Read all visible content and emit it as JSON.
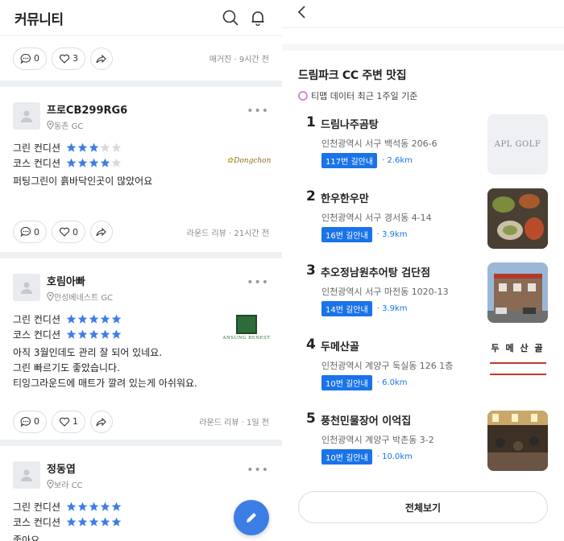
{
  "left": {
    "title": "커뮤니티",
    "top_actions": {
      "comments": "0",
      "likes": "3",
      "meta": "매거진 · 9시간 전"
    },
    "posts": [
      {
        "name": "프로CB299RG6",
        "course": "동촌 GC",
        "green_label": "그린 컨디션",
        "green_stars": 3,
        "course_label": "코스 컨디션",
        "course_stars": 4,
        "text": "퍼팅그린이 흙바닥인곳이 많았어요",
        "logo": "Dongchon",
        "comments": "0",
        "likes": "0",
        "meta": "라운드 리뷰 · 21시간 전"
      },
      {
        "name": "호림아빠",
        "course": "안성베네스트 GC",
        "green_label": "그린 컨디션",
        "green_stars": 5,
        "course_label": "코스 컨디션",
        "course_stars": 5,
        "text_lines": [
          "아직 3월인데도 관리 잘 되어 있네요.",
          "그린 빠르기도 좋았습니다.",
          "티잉그라운드에 매트가 깔려 있는게 아쉬워요."
        ],
        "logo": "ANSUNG BENEST",
        "comments": "0",
        "likes": "1",
        "meta": "라운드 리뷰 · 1일 전"
      },
      {
        "name": "정동엽",
        "course": "보라 CC",
        "green_label": "그린 컨디션",
        "green_stars": 5,
        "course_label": "코스 컨디션",
        "course_stars": 5,
        "text": "좋아요"
      }
    ]
  },
  "right": {
    "section_title": "드림파크 CC 주변 맛집",
    "section_sub": "티맵 데이터 최근 1주일 기준",
    "places": [
      {
        "rank": "1",
        "name": "드림나주곰탕",
        "addr": "인천광역시 서구 백석동 206-6",
        "bus": "117번 길안내",
        "dist": "2.6km",
        "thumb_text": "APL GOLF"
      },
      {
        "rank": "2",
        "name": "한우한우만",
        "addr": "인천광역시 서구 경서동 4-14",
        "bus": "16번 길안내",
        "dist": "3.9km"
      },
      {
        "rank": "3",
        "name": "추오정남원추어탕 검단점",
        "addr": "인천광역시 서구 마전동 1020-13",
        "bus": "14번 길안내",
        "dist": "3.9km"
      },
      {
        "rank": "4",
        "name": "두메산골",
        "addr": "인천광역시 계양구 둑실동 126 1층",
        "bus": "10번 길안내",
        "dist": "6.0km",
        "thumb_text": "두 메 산 골"
      },
      {
        "rank": "5",
        "name": "풍천민물장어 이억집",
        "addr": "인천광역시 계양구 박촌동 3-2",
        "bus": "10번 길안내",
        "dist": "10.0km"
      }
    ],
    "all_button": "전체보기"
  },
  "colors": {
    "accent": "#3d7ee6",
    "star_on": "#3d7ee6",
    "star_off": "#d6d9de",
    "bus": "#1a73e8"
  }
}
